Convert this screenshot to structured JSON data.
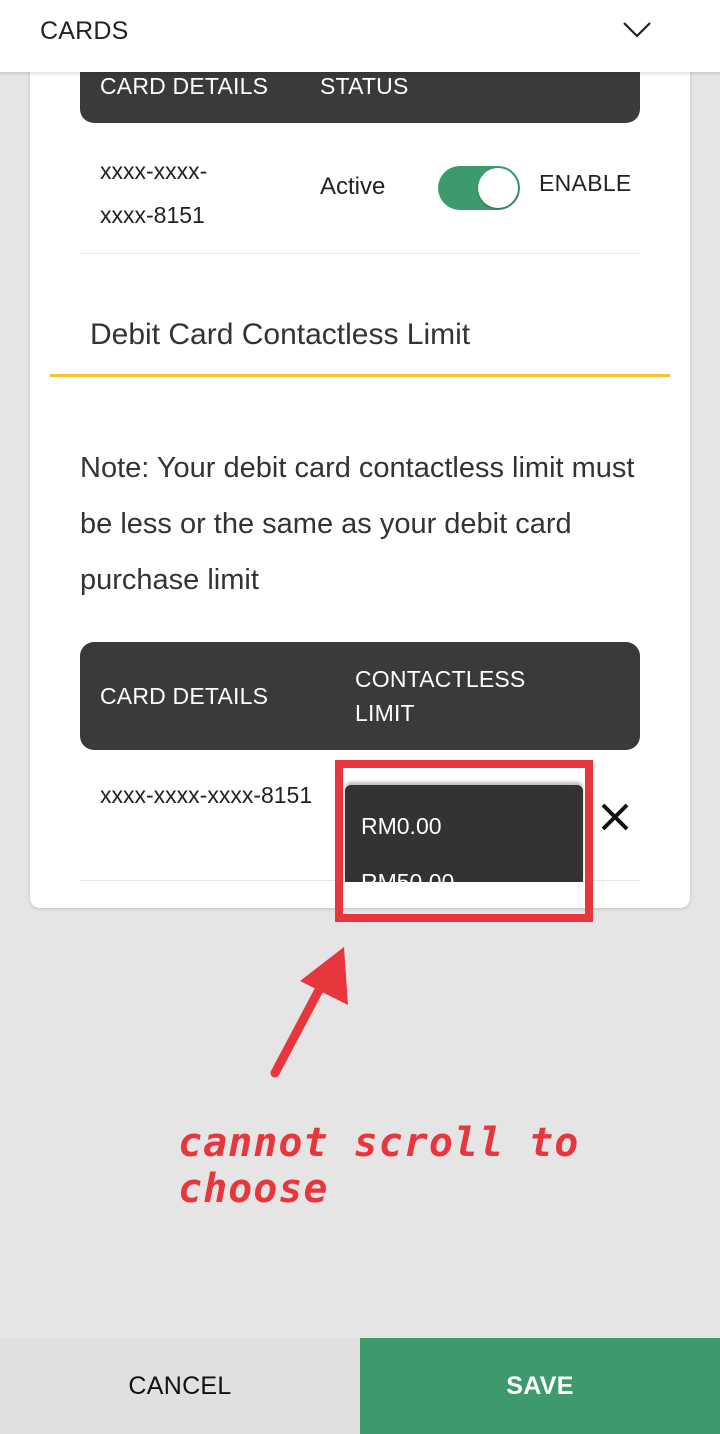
{
  "header": {
    "title": "CARDS",
    "expand_icon": "chevron-down-icon"
  },
  "status_table": {
    "col_card_details": "CARD DETAILS",
    "col_status": "STATUS",
    "row": {
      "card_number": "xxxx-xxxx-xxxx-8151",
      "status": "Active",
      "toggle_on": true,
      "toggle_label": "ENABLE"
    }
  },
  "contactless": {
    "section_title": "Debit Card Contactless Limit",
    "note": "Note: Your debit card contactless limit must be less or the same as your debit card purchase limit",
    "col_card_details": "CARD DETAILS",
    "col_limit": "CONTACTLESS LIMIT",
    "row": {
      "card_number": "xxxx-xxxx-xxxx-8151",
      "limit_options": [
        "RM0.00",
        "RM50.00"
      ],
      "close_icon": "close-icon"
    }
  },
  "annotation": {
    "text": "cannot scroll to choose",
    "color": "#e8363d"
  },
  "footer": {
    "cancel_label": "CANCEL",
    "save_label": "SAVE"
  },
  "colors": {
    "accent_green": "#3d9a6c",
    "table_header": "#3a3a3a",
    "section_underline": "#f2c531"
  }
}
